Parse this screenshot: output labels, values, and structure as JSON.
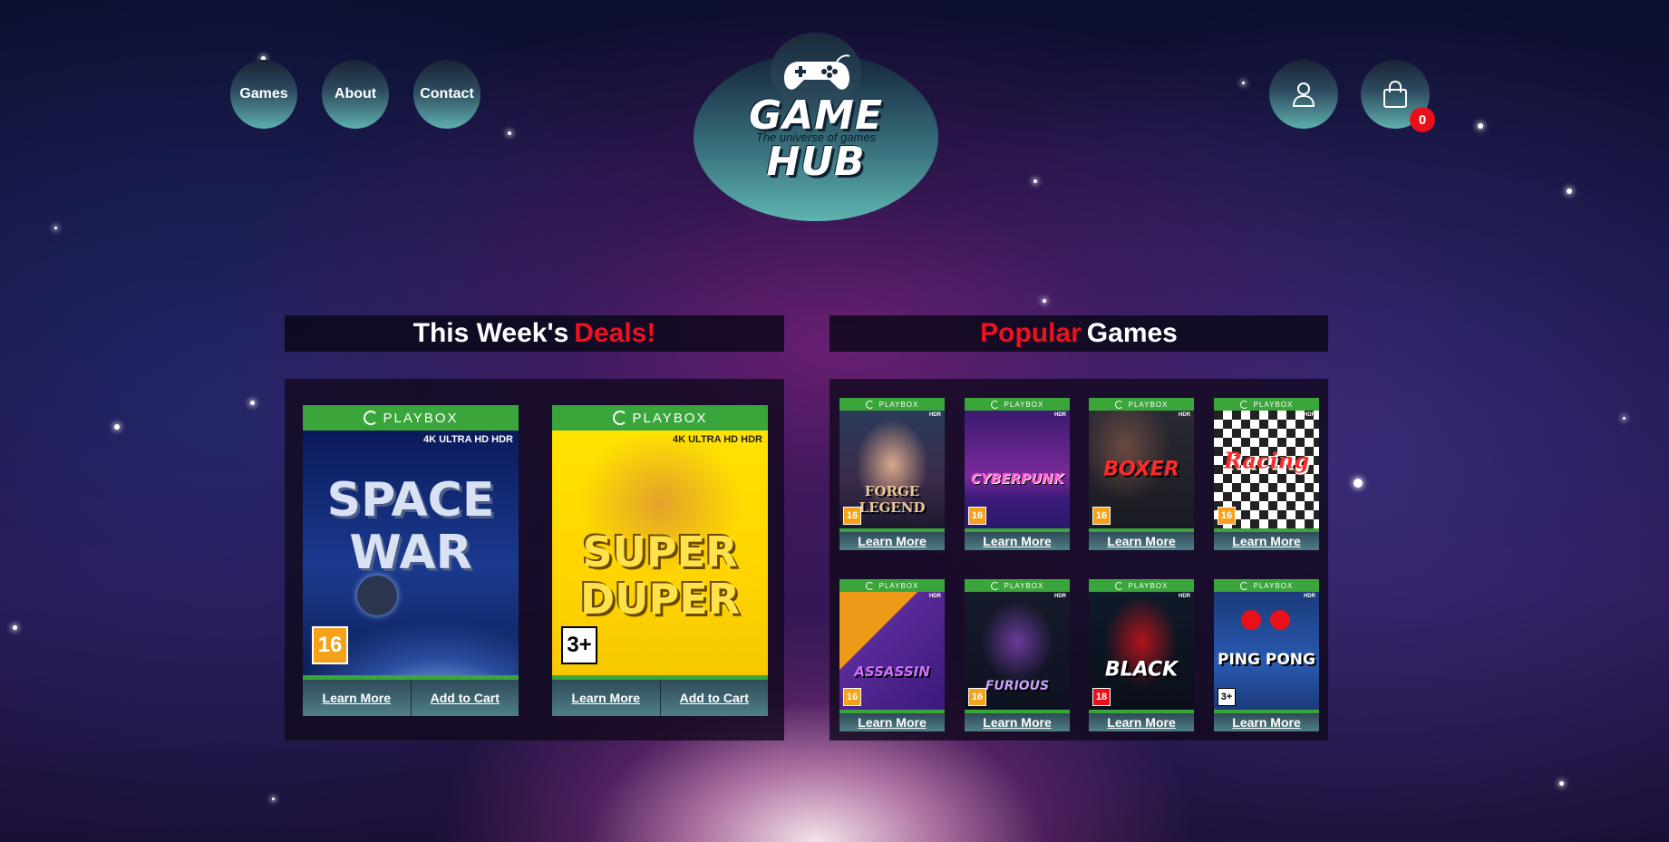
{
  "nav": {
    "games": "Games",
    "about": "About",
    "contact": "Contact"
  },
  "logo": {
    "title": "GAME HUB",
    "subtitle": "The universe of games"
  },
  "cart": {
    "count": "0"
  },
  "deals": {
    "title_white": "This Week's",
    "title_red": "Deals!",
    "cards": [
      {
        "brand": "PLAYBOX",
        "badge": "4K ULTRA HD HDR",
        "cover_title": "SPACE WAR",
        "rating": "16",
        "learn": "Learn More",
        "cart": "Add to Cart"
      },
      {
        "brand": "PLAYBOX",
        "badge": "4K ULTRA HD HDR",
        "cover_title": "SUPER DUPER",
        "rating": "3+",
        "learn": "Learn More",
        "cart": "Add to Cart"
      }
    ]
  },
  "popular": {
    "title_red": "Popular",
    "title_white": "Games",
    "tiles": [
      {
        "brand": "PLAYBOX",
        "hdr": "HDR",
        "cover_title": "FORGE LEGEND",
        "rating": "16",
        "learn": "Learn More"
      },
      {
        "brand": "PLAYBOX",
        "hdr": "HDR",
        "cover_title": "CYBERPUNK",
        "rating": "16",
        "learn": "Learn More"
      },
      {
        "brand": "PLAYBOX",
        "hdr": "HDR",
        "cover_title": "BOXER",
        "rating": "16",
        "learn": "Learn More"
      },
      {
        "brand": "PLAYBOX",
        "hdr": "HDR",
        "cover_title": "Racing",
        "rating": "16",
        "learn": "Learn More"
      },
      {
        "brand": "PLAYBOX",
        "hdr": "HDR",
        "cover_title": "ASSASSIN",
        "rating": "16",
        "learn": "Learn More"
      },
      {
        "brand": "PLAYBOX",
        "hdr": "HDR",
        "cover_title": "FURIOUS",
        "rating": "16",
        "learn": "Learn More"
      },
      {
        "brand": "PLAYBOX",
        "hdr": "HDR",
        "cover_title": "BLACK",
        "rating": "18",
        "learn": "Learn More"
      },
      {
        "brand": "PLAYBOX",
        "hdr": "HDR",
        "cover_title": "PING PONG",
        "rating": "3+",
        "learn": "Learn More"
      }
    ]
  },
  "colors": {
    "accent_red": "#ec1220",
    "playbox_green": "#3aa53a",
    "nav_teal": "#5fb0ae"
  }
}
